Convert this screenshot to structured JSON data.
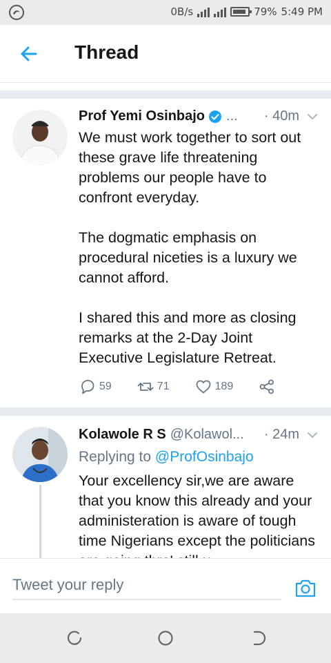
{
  "status_bar": {
    "speed": "0B/s",
    "battery_pct": "79%",
    "time": "5:49 PM",
    "icons": [
      "app-notification-icon",
      "signal-icon",
      "wifi-signal-icon",
      "battery-icon"
    ]
  },
  "header": {
    "title": "Thread",
    "back_icon": "arrow-left-icon"
  },
  "tweets": [
    {
      "name": "Prof Yemi Osinbajo",
      "handle": "...",
      "verified": true,
      "time": "· 40m",
      "text": "We must work together to sort out these grave life threatening problems our people have to confront everyday.\n\nThe dogmatic emphasis on procedural niceties is a luxury we cannot afford.\n\nI shared this and more as closing remarks at the 2-Day Joint Executive Legislature Retreat.",
      "actions": {
        "replies": "59",
        "retweets": "71",
        "likes": "189"
      }
    },
    {
      "name": "Kolawole R S",
      "handle": "@Kolawol...",
      "verified": false,
      "time": "· 24m",
      "replying_prefix": "Replying to ",
      "replying_to": "@ProfOsinbajo",
      "text": "Your excellency sir,we are aware that you know this already and your administeration is aware of tough time Nigerians except the politicians are going thro' still u"
    }
  ],
  "reply_bar": {
    "placeholder": "Tweet your reply"
  },
  "colors": {
    "accent": "#1da1f2",
    "secondary_text": "#657786",
    "divider": "#e6ecf0"
  }
}
